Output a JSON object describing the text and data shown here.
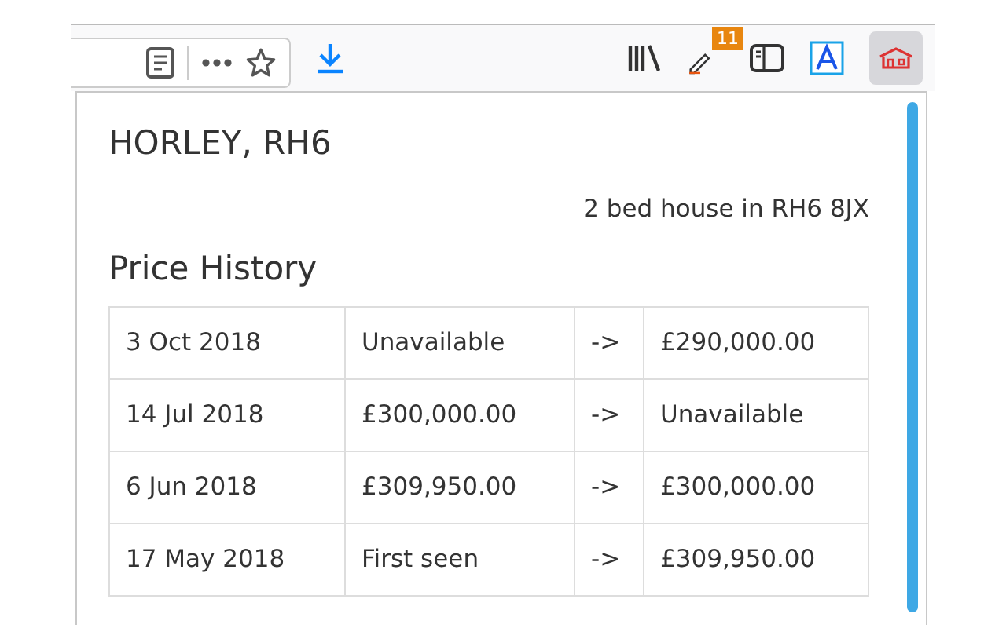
{
  "toolbar": {
    "extension_badge": "11"
  },
  "popup": {
    "title": "HORLEY, RH6",
    "subtitle": "2 bed house in RH6 8JX",
    "section_title": "Price History",
    "rows": [
      {
        "date": "3 Oct 2018",
        "from": "Unavailable",
        "arrow": "->",
        "to": "£290,000.00"
      },
      {
        "date": "14 Jul 2018",
        "from": "£300,000.00",
        "arrow": "->",
        "to": "Unavailable"
      },
      {
        "date": "6 Jun 2018",
        "from": "£309,950.00",
        "arrow": "->",
        "to": "£300,000.00"
      },
      {
        "date": "17 May 2018",
        "from": "First seen",
        "arrow": "->",
        "to": "£309,950.00"
      }
    ]
  }
}
